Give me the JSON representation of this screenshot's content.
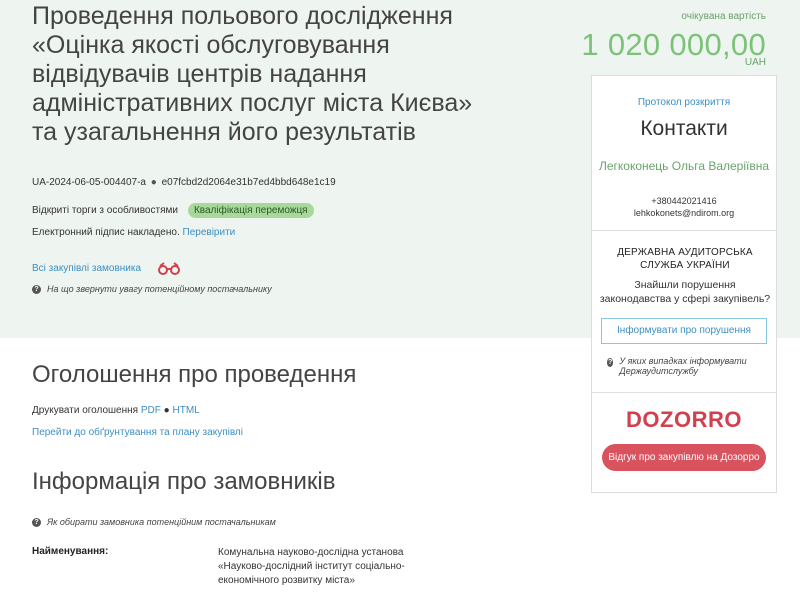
{
  "tender": {
    "title": "Проведення польового дослідження «Оцінка якості обслуговування відвідувачів центрів надання адміністративних послуг міста Києва» та узагальнення його результатів",
    "id": "UA-2024-06-05-004407-a",
    "hash": "e07fcbd2d2064e31b7ed4bbd648e1c19",
    "procedure": "Відкриті торги з особливостями",
    "status_badge": "Кваліфікація переможця",
    "signature_text": "Електронний підпис накладено.",
    "signature_link": "Перевірити",
    "all_purchases_link": "Всі закупівлі замовника",
    "supplier_hint": "На що звернути увагу потенційному постачальнику"
  },
  "price": {
    "label": "очікувана вартість",
    "value": "1 020 000,00",
    "currency": "UAH"
  },
  "contacts": {
    "protocol_link": "Протокол розкриття",
    "title": "Контакти",
    "person": "Легкоконець Ольга Валеріївна",
    "phone": "+380442021416",
    "email": "lehkokonets@ndirom.org"
  },
  "audit": {
    "title": "ДЕРЖАВНА АУДИТОРСЬКА СЛУЖБА УКРАЇНИ",
    "question": "Знайшли порушення законодавства у сфері закупівель?",
    "inform_button": "Інформувати про порушення",
    "hint": "У яких випадках інформувати Держаудитслужбу"
  },
  "dozorro": {
    "logo": "DOZORRO",
    "review_button": "Відгук про закупівлю на Дозорро"
  },
  "announcement": {
    "heading": "Оголошення про проведення",
    "print_label": "Друкувати оголошення",
    "pdf_link": "PDF",
    "html_link": "HTML",
    "plan_link": "Перейти до обґрунтування та плану закупівлі"
  },
  "customers": {
    "heading": "Інформація про замовників",
    "hint": "Як обирати замовника потенційним постачальникам",
    "name_label": "Найменування:",
    "name_value": "Комунальна науково-дослідна установа «Науково-дослідний інститут соціально-економічного розвитку міста»"
  },
  "colors": {
    "header_bg": "#eef4ef",
    "accent_green": "#7cc27a",
    "link_blue": "#3d8fc4",
    "dozorro_red": "#d2404f"
  }
}
